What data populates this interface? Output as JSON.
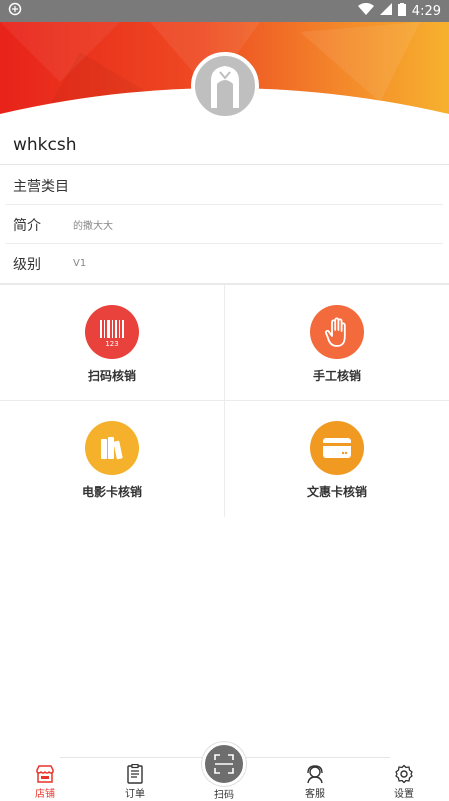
{
  "status_bar": {
    "time": "4:29"
  },
  "profile": {
    "name": "whkcsh"
  },
  "info": [
    {
      "label": "主营类目",
      "value": ""
    },
    {
      "label": "简介",
      "value": "的撒大大"
    },
    {
      "label": "级别",
      "value": "V1"
    }
  ],
  "actions": [
    {
      "label": "扫码核销",
      "icon": "barcode-icon",
      "color": "#e9413b"
    },
    {
      "label": "手工核销",
      "icon": "hand-icon",
      "color": "#f36a3c"
    },
    {
      "label": "电影卡核销",
      "icon": "book-icon",
      "color": "#f5b02c"
    },
    {
      "label": "文惠卡核销",
      "icon": "card-icon",
      "color": "#f19a22"
    }
  ],
  "tabs": [
    {
      "label": "店铺",
      "icon": "store-icon",
      "active": true
    },
    {
      "label": "订单",
      "icon": "order-icon",
      "active": false
    },
    {
      "label": "扫码",
      "icon": "scan-icon",
      "active": false
    },
    {
      "label": "客服",
      "icon": "customer-service-icon",
      "active": false
    },
    {
      "label": "设置",
      "icon": "gear-icon",
      "active": false
    }
  ],
  "colors": {
    "accent": "#e8342c",
    "hero_red": "#e62a1f",
    "hero_orange": "#f5a623"
  }
}
